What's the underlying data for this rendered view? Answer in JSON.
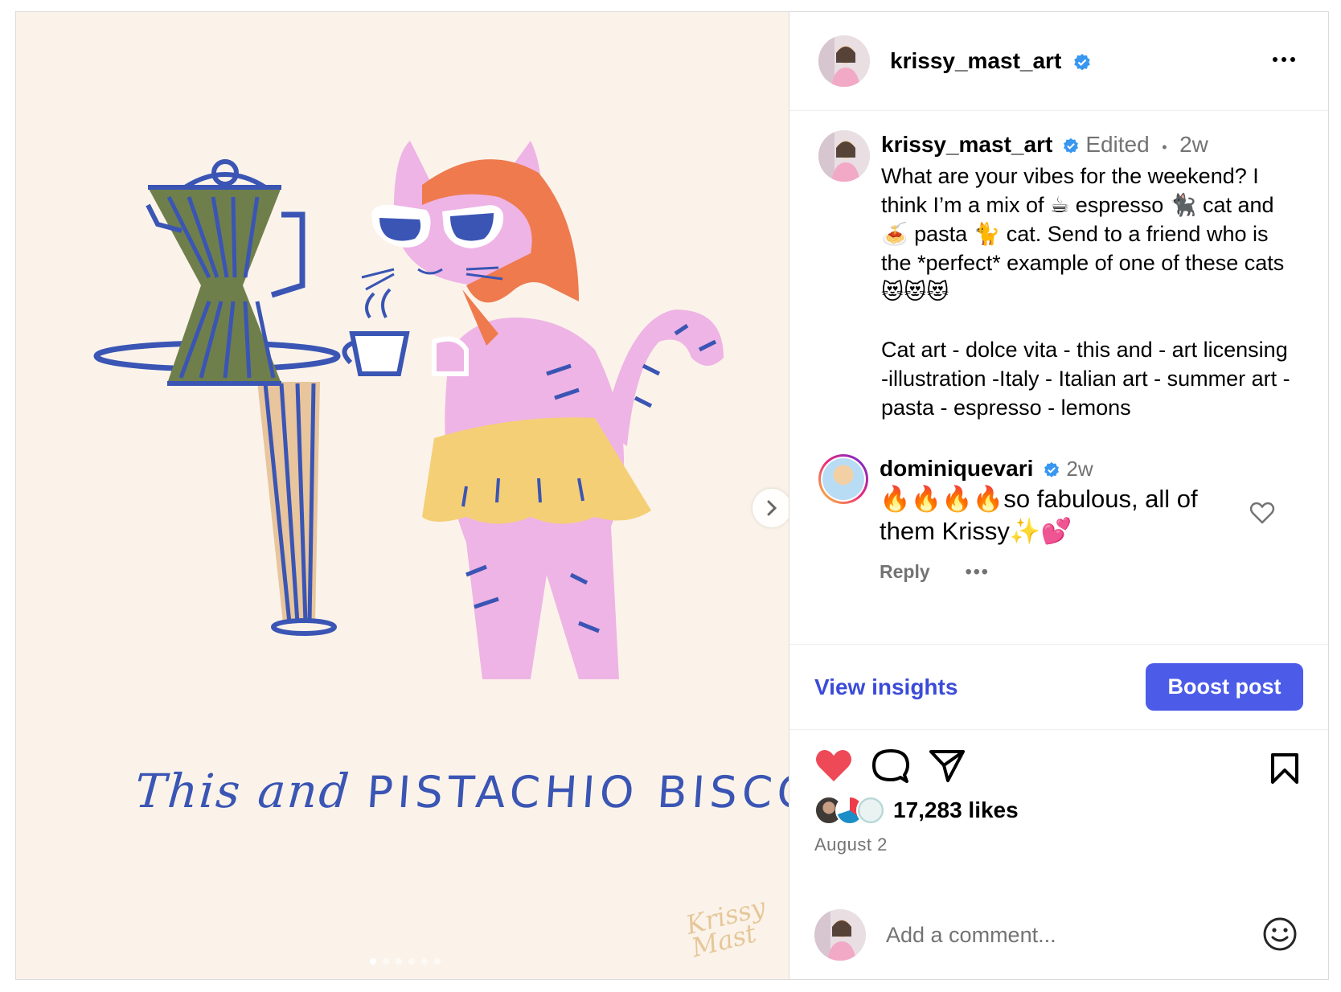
{
  "header": {
    "username": "krissy_mast_art"
  },
  "media": {
    "art_caption_script": "This and",
    "art_caption_caps": "PISTACHIO BISCOTTI",
    "signature": "Krissy\nMast",
    "carousel_total": 6,
    "carousel_active": 0
  },
  "caption": {
    "username": "krissy_mast_art",
    "edited_label": "Edited",
    "separator": "•",
    "time": "2w",
    "text": "What are your vibes for the weekend? I think I’m a mix of ☕ espresso 🐈‍⬛ cat and 🍝 pasta 🐈 cat. Send to a friend who is the *perfect* example of one of these cats 😻😻😻\n\nCat art - dolce vita - this and - art licensing -illustration -Italy - Italian art - summer art - pasta - espresso - lemons"
  },
  "comment": {
    "username": "dominiquevari",
    "time": "2w",
    "text": "🔥🔥🔥🔥so fabulous, all of them Krissy✨💕",
    "reply_label": "Reply",
    "more_label": "•••"
  },
  "insights": {
    "view_label": "View insights",
    "boost_label": "Boost post"
  },
  "actions": {
    "liked": true,
    "likes_text": "17,283 likes",
    "date": "August 2"
  },
  "add_comment": {
    "placeholder": "Add a comment..."
  },
  "colors": {
    "accent_blue": "#4c5ce8",
    "link_blue": "#3b4bd8",
    "like_red": "#ed4956",
    "verified_blue": "#3897f0",
    "muted": "#737373"
  }
}
